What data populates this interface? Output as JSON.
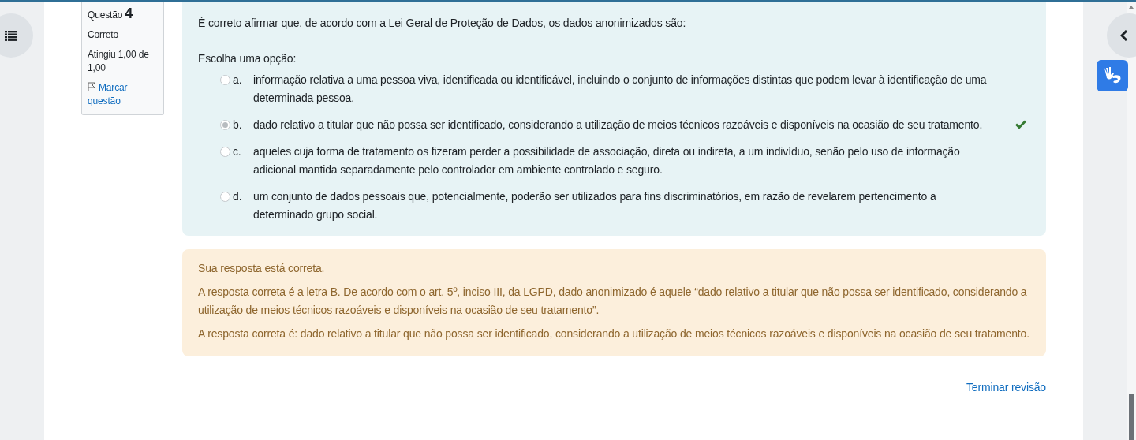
{
  "info": {
    "label": "Questão",
    "number": "4",
    "state": "Correto",
    "grade": "Atingiu 1,00 de 1,00",
    "flag_link": "Marcar questão"
  },
  "question": {
    "text": "É correto afirmar que, de acordo com a Lei Geral de Proteção de Dados, os dados anonimizados são:",
    "prompt": "Escolha uma opção:",
    "options": [
      {
        "letter": "a.",
        "text": "informação relativa a uma pessoa viva, identificada ou identificável, incluindo o conjunto de informações distintas que podem levar à identificação de uma determinada pessoa.",
        "selected": false,
        "correct": false
      },
      {
        "letter": "b.",
        "text": "dado relativo a titular que não possa ser identificado, considerando a utilização de meios técnicos razoáveis e disponíveis na ocasião de seu tratamento.",
        "selected": true,
        "correct": true
      },
      {
        "letter": "c.",
        "text": "aqueles cuja forma de tratamento os fizeram perder a possibilidade de associação, direta ou indireta, a um indivíduo, senão pelo uso de informação adicional mantida separadamente pelo controlador em ambiente controlado e seguro.",
        "selected": false,
        "correct": false
      },
      {
        "letter": "d.",
        "text": "um conjunto de dados pessoais que, potencialmente, poderão ser utilizados para fins discriminatórios, em razão de revelarem pertencimento a determinado grupo social.",
        "selected": false,
        "correct": false
      }
    ]
  },
  "feedback": {
    "status": "Sua resposta está correta.",
    "general": "A resposta correta é a letra B. De acordo com o art. 5º, inciso III, da LGPD, dado anonimizado é aquele “dado relativo a titular que não possa ser identificado, considerando a utilização de meios técnicos razoáveis e disponíveis na ocasião de seu tratamento”.",
    "right_answer": "A resposta correta é: dado relativo a titular que não possa ser identificado, considerando a utilização de meios técnicos razoáveis e disponíveis na ocasião de seu tratamento."
  },
  "finish_link": "Terminar revisão"
}
